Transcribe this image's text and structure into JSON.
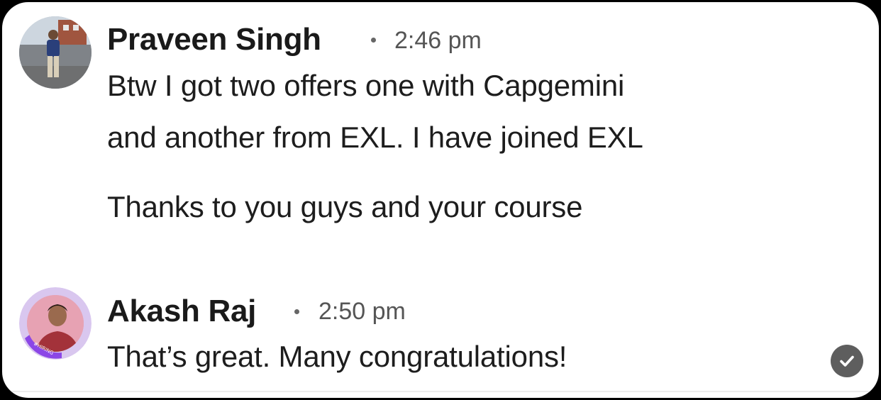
{
  "messages": [
    {
      "author": "Praveen Singh",
      "time": "2:46 pm",
      "lines": [
        "Btw I got two offers one with Capgemini",
        "and another from EXL. I have joined EXL",
        "Thanks to you guys and your course"
      ]
    },
    {
      "author": "Akash Raj",
      "time": "2:50 pm",
      "avatar_badge": "#HIRING",
      "lines": [
        "That’s great. Many congratulations!"
      ]
    }
  ],
  "colors": {
    "hiring_ring": "#8b46e6",
    "read_check": "#5e5e5e"
  },
  "icons": {
    "sender_1_avatar": "avatar-photo",
    "sender_2_avatar": "avatar-photo-hiring",
    "read_receipt": "check-circle-icon"
  }
}
